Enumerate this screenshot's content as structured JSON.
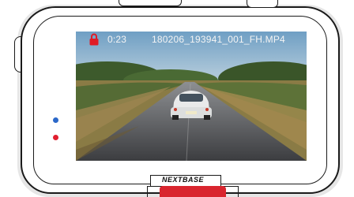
{
  "status_bar": {
    "time": "0:23",
    "filename": "180206_193941_001_FH.MP4",
    "lock_icon": "padlock-icon"
  },
  "brand": {
    "logo_text": "NEXTBASE"
  },
  "colors": {
    "status_text": "#f4f4f4",
    "lock_red": "#e01b25",
    "led_blue": "#2b68c9",
    "led_red": "#e11f2f",
    "button_red": "#d9252e"
  }
}
